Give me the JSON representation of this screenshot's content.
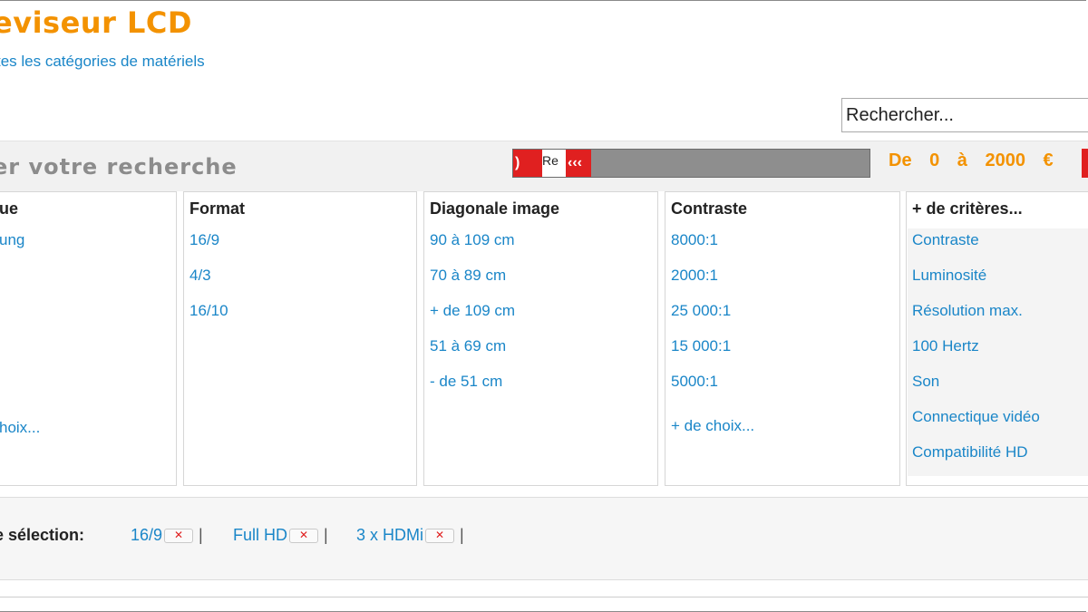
{
  "header": {
    "title": "eviseur LCD",
    "all_categories": "tes les catégories de matériels"
  },
  "search": {
    "placeholder": "Rechercher..."
  },
  "refine": {
    "label": "er votre recherche"
  },
  "price_filter": {
    "slider_min_glyph": ")",
    "slider_tip": "Re",
    "slider_max_glyph": "‹‹‹",
    "range_text": "De 0 à 2000 €",
    "min": 0,
    "max": 2000
  },
  "columns": [
    {
      "heading": "ue",
      "items": [
        "ung"
      ],
      "more": "hoix..."
    },
    {
      "heading": "Format",
      "items": [
        "16/9",
        "4/3",
        "16/10"
      ],
      "more": ""
    },
    {
      "heading": "Diagonale image",
      "items": [
        "90 à 109 cm",
        "70 à 89 cm",
        "+ de 109 cm",
        "51 à 69 cm",
        "- de 51 cm"
      ],
      "more": ""
    },
    {
      "heading": "Contraste",
      "items": [
        "8000:1",
        "2000:1",
        "25 000:1",
        "15 000:1",
        "5000:1"
      ],
      "more": "+ de choix..."
    },
    {
      "heading": "+ de critères...",
      "items": [
        "Contraste",
        "Luminosité",
        "Résolution max.",
        "100 Hertz",
        "Son",
        "Connectique vidéo",
        "Compatibilité HD"
      ],
      "more": ""
    }
  ],
  "selection": {
    "label": "e sélection:",
    "chips": [
      "16/9",
      "Full HD",
      "3 x HDMi"
    ],
    "remove_glyph": "✕",
    "separator": "|"
  }
}
